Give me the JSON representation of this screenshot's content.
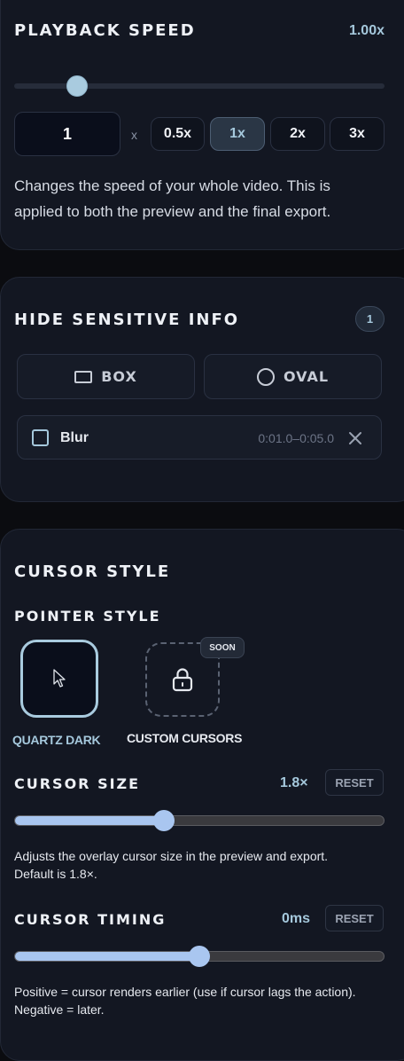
{
  "playback": {
    "title": "PLAYBACK SPEED",
    "value": "1.00x",
    "slider_fraction": 0.17,
    "input_value": "1",
    "times_label": "x",
    "presets": [
      {
        "label": "0.5x",
        "active": false
      },
      {
        "label": "1x",
        "active": true
      },
      {
        "label": "2x",
        "active": false
      },
      {
        "label": "3x",
        "active": false
      }
    ],
    "description_line1": "Changes the speed of your whole video. This is",
    "description_line2": "applied to both the preview and the final export."
  },
  "sensitive": {
    "title": "HIDE SENSITIVE INFO",
    "count": "1",
    "box_label": "BOX",
    "oval_label": "OVAL",
    "item": {
      "label": "Blur",
      "time_range": "0:01.0–0:05.0",
      "checked": false
    }
  },
  "cursor": {
    "title": "CURSOR STYLE",
    "pointer_title": "POINTER STYLE",
    "styles": [
      {
        "label": "QUARTZ DARK",
        "selected": true
      },
      {
        "label": "CUSTOM CURSORS",
        "badge": "SOON",
        "locked": true
      }
    ],
    "size": {
      "title": "CURSOR SIZE",
      "value": "1.8×",
      "reset_label": "RESET",
      "fraction": 0.405,
      "help_line1": "Adjusts the overlay cursor size in the preview and export.",
      "help_line2": "Default is 1.8×."
    },
    "timing": {
      "title": "CURSOR TIMING",
      "value": "0ms",
      "reset_label": "RESET",
      "fraction": 0.5,
      "help_line1": "Positive = cursor renders earlier (use if cursor lags the action).",
      "help_line2": "Negative = later."
    }
  },
  "colors": {
    "accent": "#a5c8dc",
    "slider_fill": "#a9c6f0",
    "panel": "#131722",
    "page": "#0b0c10"
  }
}
